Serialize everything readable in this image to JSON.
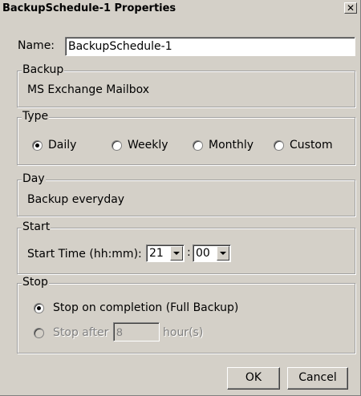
{
  "window": {
    "title": "BackupSchedule-1 Properties",
    "close_symbol": "✕"
  },
  "name": {
    "label": "Name:",
    "value": "BackupSchedule-1"
  },
  "backup": {
    "legend": "Backup",
    "value": "MS Exchange Mailbox"
  },
  "type": {
    "legend": "Type",
    "options": [
      "Daily",
      "Weekly",
      "Monthly",
      "Custom"
    ],
    "selected": "Daily"
  },
  "day": {
    "legend": "Day",
    "value": "Backup everyday"
  },
  "start": {
    "legend": "Start",
    "label": "Start Time (hh:mm):",
    "hour": "21",
    "separator": ":",
    "minute": "00"
  },
  "stop": {
    "legend": "Stop",
    "option_completion": "Stop on completion (Full Backup)",
    "option_after": "Stop after",
    "hours_value": "8",
    "hours_unit": "hour(s)",
    "selected": "completion"
  },
  "buttons": {
    "ok": "OK",
    "cancel": "Cancel"
  }
}
